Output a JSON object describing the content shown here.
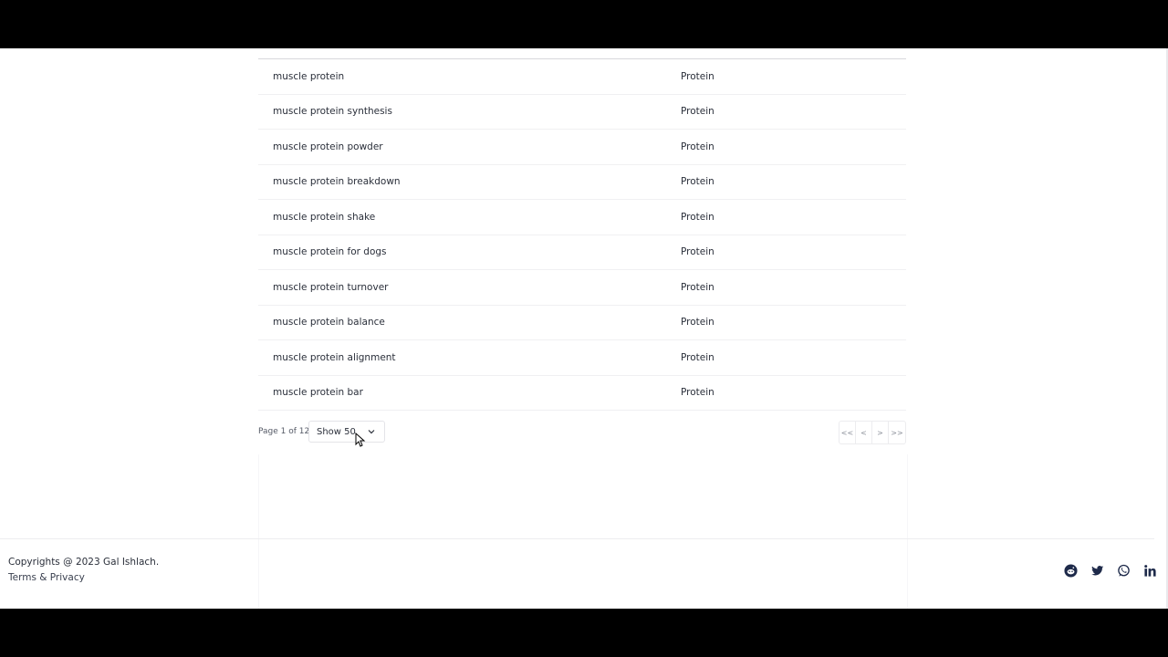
{
  "table": {
    "rows": [
      {
        "keyword": "muscle protein",
        "category": "Protein"
      },
      {
        "keyword": "muscle protein synthesis",
        "category": "Protein"
      },
      {
        "keyword": "muscle protein powder",
        "category": "Protein"
      },
      {
        "keyword": "muscle protein breakdown",
        "category": "Protein"
      },
      {
        "keyword": "muscle protein shake",
        "category": "Protein"
      },
      {
        "keyword": "muscle protein for dogs",
        "category": "Protein"
      },
      {
        "keyword": "muscle protein turnover",
        "category": "Protein"
      },
      {
        "keyword": "muscle protein balance",
        "category": "Protein"
      },
      {
        "keyword": "muscle protein alignment",
        "category": "Protein"
      },
      {
        "keyword": "muscle protein bar",
        "category": "Protein"
      }
    ]
  },
  "pagination": {
    "page_info": "Page 1 of 12",
    "show_label": "Show 50",
    "first": "<<",
    "prev": "<",
    "next": ">",
    "last": ">>"
  },
  "footer": {
    "copyright": "Copyrights @ 2023 Gal Ishlach.",
    "terms": "Terms & Privacy",
    "social_icons": [
      "reddit-icon",
      "twitter-icon",
      "whatsapp-icon",
      "linkedin-icon"
    ],
    "icon_color": "#1e2a4a"
  }
}
